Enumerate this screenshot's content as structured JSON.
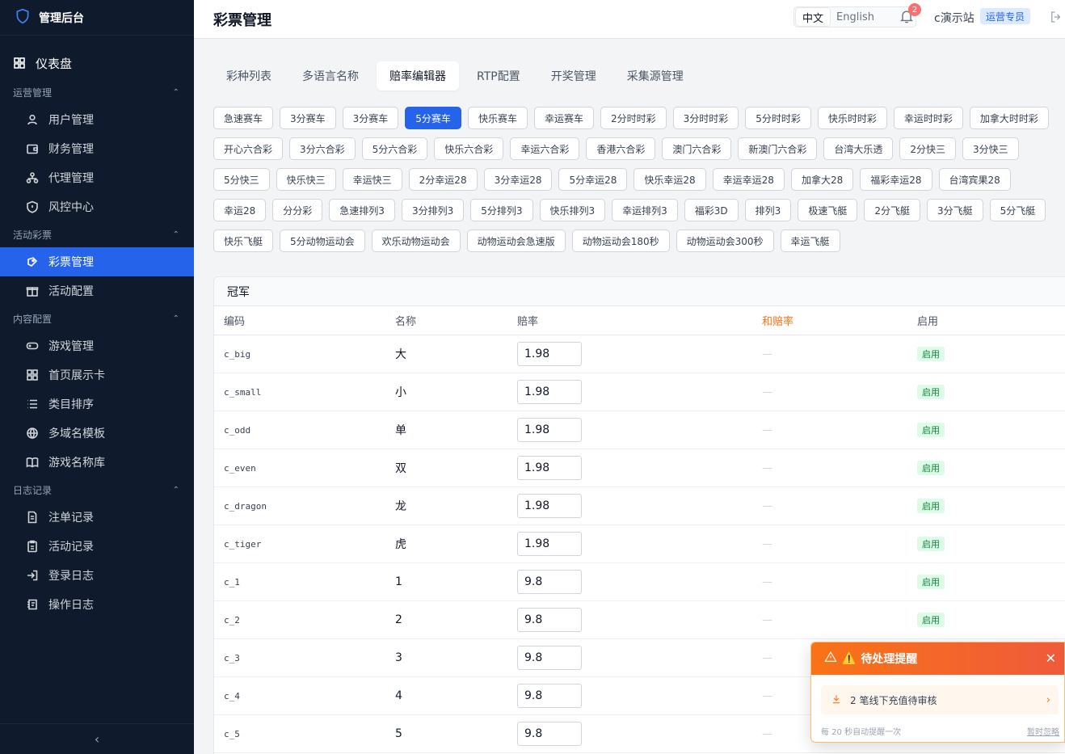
{
  "app": {
    "title": "管理后台"
  },
  "sidebar": {
    "dashboard": "仪表盘",
    "groups": [
      {
        "label": "运营管理",
        "items": [
          {
            "label": "用户管理"
          },
          {
            "label": "财务管理"
          },
          {
            "label": "代理管理"
          },
          {
            "label": "风控中心"
          }
        ]
      },
      {
        "label": "活动彩票",
        "items": [
          {
            "label": "彩票管理"
          },
          {
            "label": "活动配置"
          }
        ]
      },
      {
        "label": "内容配置",
        "items": [
          {
            "label": "游戏管理"
          },
          {
            "label": "首页展示卡"
          },
          {
            "label": "类目排序"
          },
          {
            "label": "多域名模板"
          },
          {
            "label": "游戏名称库"
          }
        ]
      },
      {
        "label": "日志记录",
        "items": [
          {
            "label": "注单记录"
          },
          {
            "label": "活动记录"
          },
          {
            "label": "登录日志"
          },
          {
            "label": "操作日志"
          }
        ]
      }
    ]
  },
  "header": {
    "title": "彩票管理",
    "lang_zh": "中文",
    "lang_en": "English",
    "notif_count": "2",
    "user": "c演示站",
    "role": "运营专员"
  },
  "tabs": [
    "彩种列表",
    "多语言名称",
    "赔率编辑器",
    "RTP配置",
    "开奖管理",
    "采集源管理"
  ],
  "lotteries": [
    "急速赛车",
    "3分赛车",
    "3分赛车",
    "5分赛车",
    "快乐赛车",
    "幸运赛车",
    "2分时时彩",
    "3分时时彩",
    "5分时时彩",
    "快乐时时彩",
    "幸运时时彩",
    "加拿大时时彩",
    "开心六合彩",
    "3分六合彩",
    "5分六合彩",
    "快乐六合彩",
    "幸运六合彩",
    "香港六合彩",
    "澳门六合彩",
    "新澳门六合彩",
    "台湾大乐透",
    "2分快三",
    "3分快三",
    "5分快三",
    "快乐快三",
    "幸运快三",
    "2分幸运28",
    "3分幸运28",
    "5分幸运28",
    "快乐幸运28",
    "幸运幸运28",
    "加拿大28",
    "福彩幸运28",
    "台湾宾果28",
    "幸运28",
    "分分彩",
    "急速排列3",
    "3分排列3",
    "5分排列3",
    "快乐排列3",
    "幸运排列3",
    "福彩3D",
    "排列3",
    "极速飞艇",
    "2分飞艇",
    "3分飞艇",
    "5分飞艇",
    "快乐飞艇",
    "5分动物运动会",
    "欢乐动物运动会",
    "动物运动会急速版",
    "动物运动会180秒",
    "动物运动会300秒",
    "幸运飞艇"
  ],
  "panel": {
    "title": "冠军",
    "columns": {
      "code": "编码",
      "name": "名称",
      "odds": "赔率",
      "he_odds": "和赔率",
      "enabled": "启用"
    },
    "rows": [
      {
        "code": "c_big",
        "name": "大",
        "odds": "1.98",
        "he": "—",
        "enabled": "启用"
      },
      {
        "code": "c_small",
        "name": "小",
        "odds": "1.98",
        "he": "—",
        "enabled": "启用"
      },
      {
        "code": "c_odd",
        "name": "单",
        "odds": "1.98",
        "he": "—",
        "enabled": "启用"
      },
      {
        "code": "c_even",
        "name": "双",
        "odds": "1.98",
        "he": "—",
        "enabled": "启用"
      },
      {
        "code": "c_dragon",
        "name": "龙",
        "odds": "1.98",
        "he": "—",
        "enabled": "启用"
      },
      {
        "code": "c_tiger",
        "name": "虎",
        "odds": "1.98",
        "he": "—",
        "enabled": "启用"
      },
      {
        "code": "c_1",
        "name": "1",
        "odds": "9.8",
        "he": "—",
        "enabled": "启用"
      },
      {
        "code": "c_2",
        "name": "2",
        "odds": "9.8",
        "he": "—",
        "enabled": "启用"
      },
      {
        "code": "c_3",
        "name": "3",
        "odds": "9.8",
        "he": "—",
        "enabled": ""
      },
      {
        "code": "c_4",
        "name": "4",
        "odds": "9.8",
        "he": "—",
        "enabled": ""
      },
      {
        "code": "c_5",
        "name": "5",
        "odds": "9.8",
        "he": "—",
        "enabled": ""
      }
    ]
  },
  "toast": {
    "title": "待处理提醒",
    "item": "2 笔线下充值待审核",
    "footer": "每 20 秒自动提醒一次",
    "ignore": "暂时忽略"
  },
  "colors": {
    "accent": "#2563eb",
    "sidebar_bg": "#0f1b2d",
    "warning": "#f97316"
  }
}
